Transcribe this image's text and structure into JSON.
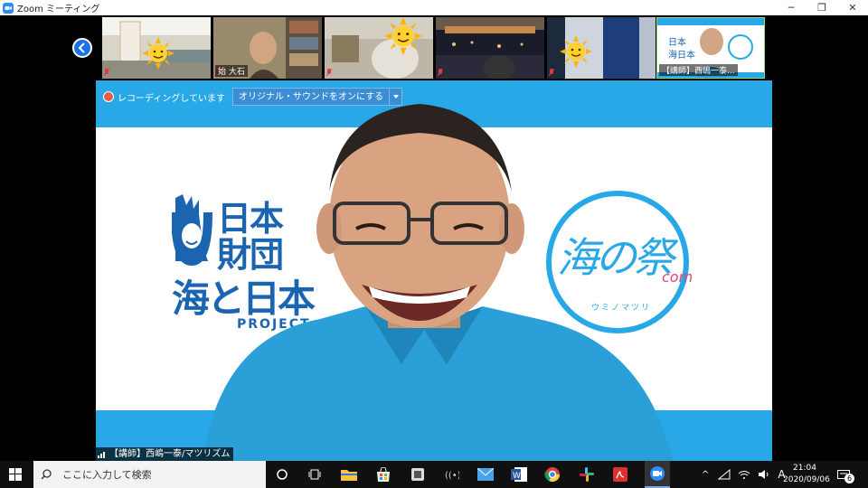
{
  "window": {
    "title": "Zoom ミーティング",
    "minimize": "─",
    "restore": "❐",
    "close": "✕"
  },
  "participants": [
    {
      "name": ""
    },
    {
      "name": "始 大石"
    },
    {
      "name": ""
    },
    {
      "name": ""
    },
    {
      "name": ""
    },
    {
      "name": "【講師】西嶋一泰..."
    }
  ],
  "recording": {
    "status": "レコーディングしています",
    "sound_button": "オリジナル・サウンドをオンにする"
  },
  "speaker": {
    "name": "【講師】西嶋一泰/マツリズム"
  },
  "slide": {
    "logo_left_lines": [
      "日本",
      "財団",
      "海と日本",
      "PROJECT"
    ],
    "logo_right_main": "海の祭",
    "logo_right_suffix": "com",
    "logo_right_kana": "ウミノマツリ"
  },
  "taskbar": {
    "search_placeholder": "ここに入力して検索",
    "time": "21:04",
    "date": "2020/09/06",
    "notification_count": "6",
    "ime": "A"
  },
  "colors": {
    "band": "#29a8e8",
    "zoom_blue": "#2d8cff",
    "active_speaker_border": "#8ddf6e"
  }
}
